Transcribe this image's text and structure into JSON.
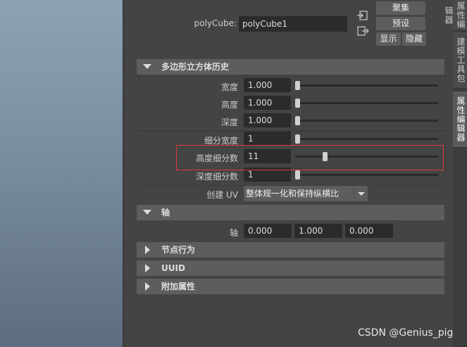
{
  "node": {
    "label": "polyCube:",
    "value": "polyCube1"
  },
  "buttons": {
    "focus": "聚集",
    "presets": "预设",
    "show": "显示",
    "hide": "隐藏"
  },
  "history_section": {
    "title": "多边形立方体历史",
    "rows": [
      {
        "label": "宽度",
        "value": "1.000",
        "slider_fraction": 0.0
      },
      {
        "label": "高度",
        "value": "1.000",
        "slider_fraction": 0.0
      },
      {
        "label": "深度",
        "value": "1.000",
        "slider_fraction": 0.0
      },
      {
        "label": "细分宽度",
        "value": "1",
        "slider_fraction": 0.0
      },
      {
        "label": "高度细分数",
        "value": "11",
        "slider_fraction": 0.2
      },
      {
        "label": "深度细分数",
        "value": "1",
        "slider_fraction": 0.0
      }
    ],
    "create_uv": {
      "label": "创建 UV",
      "value": "整体规一化和保持纵横比"
    }
  },
  "axis_section": {
    "title": "轴",
    "label": "轴",
    "values": [
      "0.000",
      "1.000",
      "0.000"
    ]
  },
  "collapsed_sections": [
    "节点行为",
    "UUID",
    "附加属性"
  ],
  "side_tabs": [
    {
      "label": "属性编辑器",
      "active": false
    },
    {
      "label": "建模工具包",
      "active": false
    },
    {
      "label": "属性编辑器",
      "active": true
    }
  ],
  "watermark": "CSDN @Genius_pig",
  "colors": {
    "highlight_box": "#dd3a3a",
    "panel_bg": "#444444",
    "header_bg": "#5d5d5d",
    "field_bg": "#2b2b2b"
  }
}
